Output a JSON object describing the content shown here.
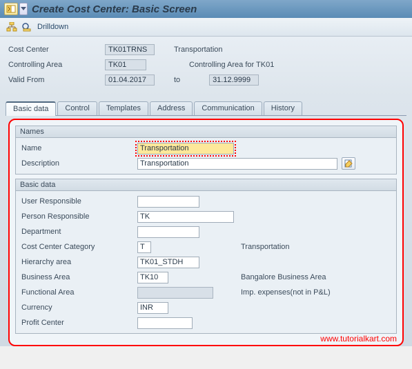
{
  "title": "Create Cost Center: Basic Screen",
  "toolbar": {
    "drilldown_label": "Drilldown"
  },
  "header": {
    "cost_center_label": "Cost Center",
    "cost_center_value": "TK01TRNS",
    "cost_center_desc": "Transportation",
    "controlling_area_label": "Controlling Area",
    "controlling_area_value": "TK01",
    "controlling_area_desc": "Controlling Area for TK01",
    "valid_from_label": "Valid From",
    "valid_from_value": "01.04.2017",
    "to_label": "to",
    "valid_to_value": "31.12.9999"
  },
  "tabs": {
    "basic_data": "Basic data",
    "control": "Control",
    "templates": "Templates",
    "address": "Address",
    "communication": "Communication",
    "history": "History"
  },
  "names_group": {
    "title": "Names",
    "name_label": "Name",
    "name_value": "Transportation",
    "description_label": "Description",
    "description_value": "Transportation"
  },
  "basic_data_group": {
    "title": "Basic data",
    "user_responsible_label": "User Responsible",
    "user_responsible_value": "",
    "person_responsible_label": "Person Responsible",
    "person_responsible_value": "TK",
    "department_label": "Department",
    "department_value": "",
    "cost_center_category_label": "Cost Center Category",
    "cost_center_category_value": "T",
    "cost_center_category_desc": "Transportation",
    "hierarchy_area_label": "Hierarchy area",
    "hierarchy_area_value": "TK01_STDH",
    "business_area_label": "Business Area",
    "business_area_value": "TK10",
    "business_area_desc": "Bangalore Business Area",
    "functional_area_label": "Functional Area",
    "functional_area_value": "",
    "functional_area_desc": "Imp. expenses(not in P&L)",
    "currency_label": "Currency",
    "currency_value": "INR",
    "profit_center_label": "Profit Center",
    "profit_center_value": ""
  },
  "watermark": "www.tutorialkart.com"
}
